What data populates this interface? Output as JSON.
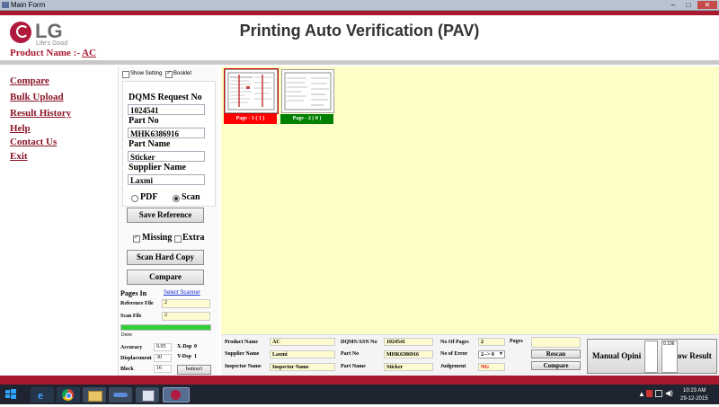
{
  "window": {
    "title": "Main Form",
    "minimize": "–",
    "maximize": "□",
    "close": "✕"
  },
  "header": {
    "logo_text": "LG",
    "logo_tagline": "Life's Good",
    "app_title": "Printing Auto Verification (PAV)",
    "product_label": "Product Name :-",
    "product_value": "AC"
  },
  "nav": [
    "Compare",
    "Bulk Upload",
    "Result History",
    "Help",
    "Contact Us",
    "Exit"
  ],
  "settings": {
    "show_setting_label": "Show Setting",
    "show_setting_checked": false,
    "booklet_label": "Booklet",
    "booklet_checked": true,
    "dqms_label": "DQMS Request No",
    "dqms_value": "1024541",
    "part_no_label": "Part No",
    "part_no_value": "MHK6386916",
    "part_name_label": "Part Name",
    "part_name_value": "Sticker",
    "supplier_label": "Supplier Name",
    "supplier_value": "Laxmi",
    "pdf_label": "PDF",
    "scan_label": "Scan",
    "save_reference": "Save Reference",
    "missing_label": "Missing",
    "missing_checked": true,
    "extra_label": "Extra",
    "extra_checked": false,
    "scan_hard_copy": "Scan Hard Copy",
    "compare": "Compare"
  },
  "pages_in": {
    "title": "Pages In",
    "select_scanner": "Select Scanner",
    "reference_file_label": "Reference File",
    "reference_file_value": "2",
    "scan_file_label": "Scan File",
    "scan_file_value": "2",
    "progress_fraction": 1.0,
    "status": "Done"
  },
  "metrics": {
    "accuracy_label": "Accuracy",
    "accuracy_value": "0.95",
    "xdsp_label": "X-Dsp",
    "xdsp_value": "0",
    "displacement_label": "Displacement",
    "displacement_value": "30",
    "ydsp_label": "Y-Dsp",
    "ydsp_value": "1",
    "block_label": "Block",
    "block_value": "16",
    "button3": "button3"
  },
  "pages": [
    {
      "label": "Page - 1 ( 1 )",
      "color": "#ff0000"
    },
    {
      "label": "Page - 2 ( 0 )",
      "color": "#008000"
    }
  ],
  "result": {
    "product_name_label": "Product Name",
    "product_name_value": "AC",
    "supplier_label": "Supplier Name",
    "supplier_value": "Laxmi",
    "inspector_label": "Inspector Name",
    "inspector_value": "Inspector Name",
    "dqms_label": "DQMS/ASN No",
    "dqms_value": "1024541",
    "part_no_label": "Part No",
    "part_no_value": "MHK6386916",
    "part_name_label": "Part Name",
    "part_name_value": "Sticker",
    "no_pages_label": "No Of Pages",
    "no_pages_value": "2",
    "no_error_label": "No of Error",
    "no_error_value": "2--> 0",
    "judgement_label": "Judgement",
    "judgement_value": "NG",
    "pages_label": "Pages",
    "rescan": "Rescan",
    "compare": "Compare",
    "manual_opinion": "Manual Opini",
    "show_result": "ow Result",
    "overlay_value": "0.196"
  },
  "taskbar": {
    "time": "10:23 AM",
    "date": "29-12-2015"
  },
  "colors": {
    "maroon": "#a8182e",
    "preview_bg": "#fefec8",
    "field_bg": "#fffbd0"
  }
}
